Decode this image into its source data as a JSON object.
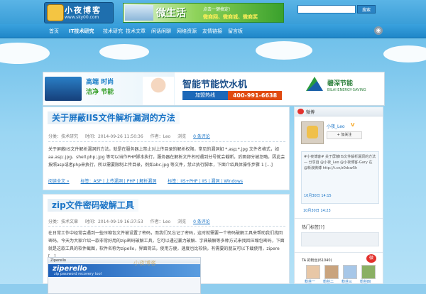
{
  "header": {
    "logo_title": "小夜博客",
    "logo_url": "www.sky00.com",
    "top_ad": {
      "big": "微生活",
      "line1": "点击一键搞定!",
      "line2": "微商网、微商城、微商奖"
    },
    "search": {
      "placeholder": "",
      "button": "搜索"
    }
  },
  "nav": {
    "items": [
      {
        "label": "首页"
      },
      {
        "label": "IT技术研究",
        "active": true
      },
      {
        "label": "技术研究"
      },
      {
        "label": "技术文章"
      },
      {
        "label": "闲话闲聊"
      },
      {
        "label": "网络资源"
      },
      {
        "label": "友情链接"
      },
      {
        "label": "留言板"
      }
    ]
  },
  "banner": {
    "slogan1": "高端 时尚",
    "slogan2": "洁净 节能",
    "headline": "智能节能饮水机",
    "hotline_label": "加盟热线",
    "hotline": "400-991-6638",
    "brand": "碧深节能",
    "brand_en": "BILAI ENERGY-SAVING"
  },
  "posts": [
    {
      "title": "关于屏蔽IIS文件解析漏洞的方法",
      "meta": {
        "category": "分类：技术研究",
        "date": "时间：2014-09-26 11:50:36",
        "author": "作者：Leo",
        "views": "浏览",
        "comments": "0 条评论"
      },
      "excerpt_html": "关于屏蔽IIS文件解析漏洞的方法，就是在服务器上禁止对上传目录的解析权限，常见的漏洞如 *.asp;*.jpg 文件名格式，如 aa.asp;.jpg、shell.php;.jpg 等可以当作PHP脚本执行，服务器在解析文件名时遇到分号就会截断，后面部分被忽略，因此会按照asp或者php来执行，所以需要限制上传目录，例如abc.jpg 等文件，禁止执行脚本，下面介绍具体操作步骤 1 [...]",
      "read_more": "阅读全文 »",
      "tags": "标签：ASP | 上传漏洞 | PHP | 解析漏洞",
      "tags2": "标签：IIS+PHP | IIS | 漏洞 | Windows"
    },
    {
      "title": "zip文件密码破解工具",
      "meta": {
        "category": "分类：技术文章",
        "date": "时间：2014-09-19 16:37:53",
        "author": "作者：Leo",
        "views": "浏览",
        "comments": "0 条评论"
      },
      "excerpt": "在日常工作中经常会遇到一些压缩包文件被设置了密码，而我们又忘记了密码，这时就需要一个密码破解工具来帮助我们找回密码，今天为大家介绍一款非常好用的zip密码破解工具，它可以通过暴力破解、字典破解等多种方式来找回压缩包密码，下面就是这款工具的软件截图，软件名称为zipello，界面简洁，使用方便，速度也比较快，有需要的朋友可以下载使用，zipere [...]",
      "image": {
        "window_title": "Ziperello",
        "name": "ziperello",
        "subtitle": "zip password recovery tool",
        "watermark": "小夜博客"
      }
    }
  ],
  "sidebar": {
    "header": "微博",
    "name": "小夜_Leo",
    "follow": "+ 加关注",
    "weibo_text_html": "#小夜博客# 关于屏蔽IIS文件解析漏洞的方法 — 分享自 @小夜_Leo @小夜博客-Gary 在 @新浪微博 http://t.cn/z0dcw5h",
    "time1": "10月30日 14:15",
    "time2": "10月30日 14:23",
    "hot_label": "热门标签[?]",
    "fans_label": "TA 的粉丝(61040)",
    "fans": [
      {
        "name": "粉丝一",
        "color": "#e8c7a6"
      },
      {
        "name": "粉丝二",
        "color": "#c9a37d"
      },
      {
        "name": "粉丝三",
        "color": "#a7c7e8"
      },
      {
        "name": "粉丝四",
        "color": "#8bb064"
      }
    ]
  },
  "colors": {
    "accent": "#1a74c6",
    "nav": "#2a8fd0",
    "weibo": "#e3312d"
  }
}
